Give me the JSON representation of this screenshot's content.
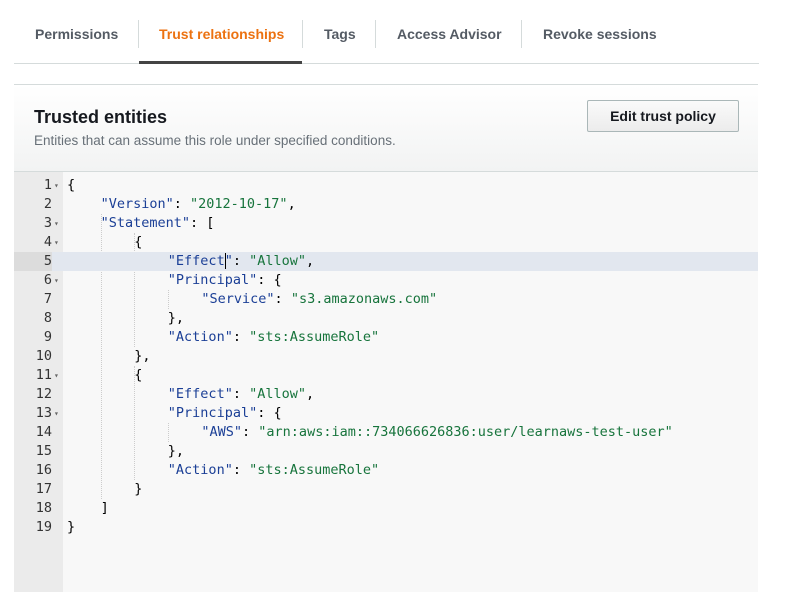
{
  "tabs": [
    {
      "label": "Permissions",
      "active": false
    },
    {
      "label": "Trust relationships",
      "active": true
    },
    {
      "label": "Tags",
      "active": false
    },
    {
      "label": "Access Advisor",
      "active": false
    },
    {
      "label": "Revoke sessions",
      "active": false
    }
  ],
  "panel": {
    "title": "Trusted entities",
    "description": "Entities that can assume this role under specified conditions.",
    "edit_button": "Edit trust policy"
  },
  "colors": {
    "accent": "#ec7211",
    "key": "#1b3f96",
    "string": "#17743c"
  },
  "editor": {
    "cursor_line": 5,
    "lines": [
      {
        "n": "1",
        "fold": true,
        "indent": 0,
        "parts": [
          [
            "p",
            "{"
          ]
        ]
      },
      {
        "n": "2",
        "fold": false,
        "indent": 1,
        "parts": [
          [
            "k",
            "\"Version\""
          ],
          [
            "p",
            ": "
          ],
          [
            "s",
            "\"2012-10-17\""
          ],
          [
            "p",
            ","
          ]
        ]
      },
      {
        "n": "3",
        "fold": true,
        "indent": 1,
        "parts": [
          [
            "k",
            "\"Statement\""
          ],
          [
            "p",
            ": ["
          ]
        ]
      },
      {
        "n": "4",
        "fold": true,
        "indent": 2,
        "parts": [
          [
            "p",
            "{"
          ]
        ]
      },
      {
        "n": "5",
        "fold": false,
        "indent": 3,
        "parts": [
          [
            "k",
            "\"Effect"
          ],
          [
            "c",
            ""
          ],
          [
            "k",
            "\""
          ],
          [
            "p",
            ": "
          ],
          [
            "s",
            "\"Allow\""
          ],
          [
            "p",
            ","
          ]
        ]
      },
      {
        "n": "6",
        "fold": true,
        "indent": 3,
        "parts": [
          [
            "k",
            "\"Principal\""
          ],
          [
            "p",
            ": {"
          ]
        ]
      },
      {
        "n": "7",
        "fold": false,
        "indent": 4,
        "parts": [
          [
            "k",
            "\"Service\""
          ],
          [
            "p",
            ": "
          ],
          [
            "s",
            "\"s3.amazonaws.com\""
          ]
        ]
      },
      {
        "n": "8",
        "fold": false,
        "indent": 3,
        "parts": [
          [
            "p",
            "},"
          ]
        ]
      },
      {
        "n": "9",
        "fold": false,
        "indent": 3,
        "parts": [
          [
            "k",
            "\"Action\""
          ],
          [
            "p",
            ": "
          ],
          [
            "s",
            "\"sts:AssumeRole\""
          ]
        ]
      },
      {
        "n": "10",
        "fold": false,
        "indent": 2,
        "parts": [
          [
            "p",
            "},"
          ]
        ]
      },
      {
        "n": "11",
        "fold": true,
        "indent": 2,
        "parts": [
          [
            "p",
            "{"
          ]
        ]
      },
      {
        "n": "12",
        "fold": false,
        "indent": 3,
        "parts": [
          [
            "k",
            "\"Effect\""
          ],
          [
            "p",
            ": "
          ],
          [
            "s",
            "\"Allow\""
          ],
          [
            "p",
            ","
          ]
        ]
      },
      {
        "n": "13",
        "fold": true,
        "indent": 3,
        "parts": [
          [
            "k",
            "\"Principal\""
          ],
          [
            "p",
            ": {"
          ]
        ]
      },
      {
        "n": "14",
        "fold": false,
        "indent": 4,
        "parts": [
          [
            "k",
            "\"AWS\""
          ],
          [
            "p",
            ": "
          ],
          [
            "s",
            "\"arn:aws:iam::734066626836:user/learnaws-test-user\""
          ]
        ]
      },
      {
        "n": "15",
        "fold": false,
        "indent": 3,
        "parts": [
          [
            "p",
            "},"
          ]
        ]
      },
      {
        "n": "16",
        "fold": false,
        "indent": 3,
        "parts": [
          [
            "k",
            "\"Action\""
          ],
          [
            "p",
            ": "
          ],
          [
            "s",
            "\"sts:AssumeRole\""
          ]
        ]
      },
      {
        "n": "17",
        "fold": false,
        "indent": 2,
        "parts": [
          [
            "p",
            "}"
          ]
        ]
      },
      {
        "n": "18",
        "fold": false,
        "indent": 1,
        "parts": [
          [
            "p",
            "]"
          ]
        ]
      },
      {
        "n": "19",
        "fold": false,
        "indent": 0,
        "parts": [
          [
            "p",
            "}"
          ]
        ]
      }
    ]
  }
}
